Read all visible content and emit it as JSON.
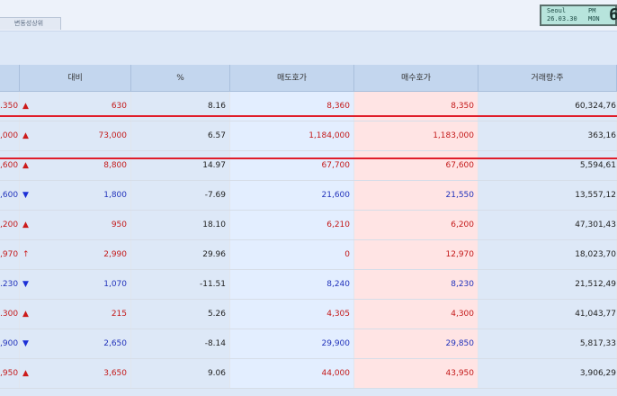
{
  "window": {
    "tab_label": "변동성상위",
    "clock": {
      "city": "Seoul",
      "ampm": "PM",
      "datetime": "26.03.30",
      "weekday": "MON",
      "big": "6"
    }
  },
  "table": {
    "headers": [
      "대비",
      "%",
      "매도호가",
      "매수호가",
      "거래량:주"
    ],
    "rows": [
      {
        "price": ".350",
        "dir": "up",
        "arrow": "▲",
        "change": "630",
        "pct": "8.16",
        "sell": "8,360",
        "buy": "8,350",
        "volume": "60,324,76"
      },
      {
        "price": ",000",
        "dir": "up",
        "arrow": "▲",
        "change": "73,000",
        "pct": "6.57",
        "sell": "1,184,000",
        "buy": "1,183,000",
        "volume": "363,16"
      },
      {
        "price": ",600",
        "dir": "up",
        "arrow": "▲",
        "change": "8,800",
        "pct": "14.97",
        "sell": "67,700",
        "buy": "67,600",
        "volume": "5,594,61"
      },
      {
        "price": ",600",
        "dir": "down",
        "arrow": "▼",
        "change": "1,800",
        "pct": "-7.69",
        "sell": "21,600",
        "buy": "21,550",
        "volume": "13,557,12"
      },
      {
        "price": ",200",
        "dir": "up",
        "arrow": "▲",
        "change": "950",
        "pct": "18.10",
        "sell": "6,210",
        "buy": "6,200",
        "volume": "47,301,43"
      },
      {
        "price": ",970",
        "dir": "up",
        "arrow": "↑",
        "change": "2,990",
        "pct": "29.96",
        "sell": "0",
        "buy": "12,970",
        "volume": "18,023,70"
      },
      {
        "price": ".230",
        "dir": "down",
        "arrow": "▼",
        "change": "1,070",
        "pct": "-11.51",
        "sell": "8,240",
        "buy": "8,230",
        "volume": "21,512,49"
      },
      {
        "price": ".300",
        "dir": "up",
        "arrow": "▲",
        "change": "215",
        "pct": "5.26",
        "sell": "4,305",
        "buy": "4,300",
        "volume": "41,043,77"
      },
      {
        "price": ",900",
        "dir": "down",
        "arrow": "▼",
        "change": "2,650",
        "pct": "-8.14",
        "sell": "29,900",
        "buy": "29,850",
        "volume": "5,817,33"
      },
      {
        "price": ",950",
        "dir": "up",
        "arrow": "▲",
        "change": "3,650",
        "pct": "9.06",
        "sell": "44,000",
        "buy": "43,950",
        "volume": "3,906,29"
      }
    ]
  }
}
